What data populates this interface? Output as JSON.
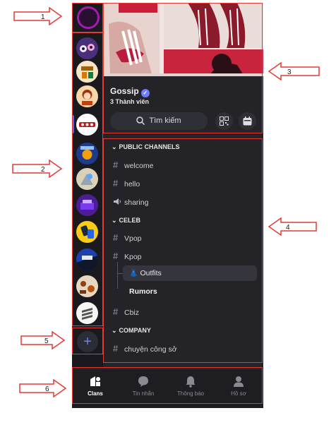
{
  "colors": {
    "accent": "#5865f2",
    "annotation": "#e53935",
    "background": "#232328"
  },
  "server": {
    "name": "Gossip",
    "members": "3 Thành viên"
  },
  "search": {
    "label": "Tìm kiếm"
  },
  "rail": {
    "avatars": [
      "server-1",
      "server-2",
      "server-3",
      "server-4",
      "server-5",
      "server-6",
      "server-7",
      "server-8",
      "server-9",
      "server-10",
      "server-11"
    ]
  },
  "categories": {
    "public": {
      "label": "PUBLIC CHANNELS",
      "channels": [
        "welcome",
        "hello",
        "sharing"
      ]
    },
    "celeb": {
      "label": "CELEB",
      "channels": [
        "Vpop",
        "Kpop"
      ],
      "threads": [
        "Outfits",
        "Rumors"
      ],
      "after": "Cbiz"
    },
    "company": {
      "label": "COMPANY",
      "channels": [
        "chuyện công sở"
      ]
    }
  },
  "tabs": [
    {
      "label": "Clans",
      "icon": "clans-icon"
    },
    {
      "label": "Tin nhắn",
      "icon": "chat-bubble-icon"
    },
    {
      "label": "Thông báo",
      "icon": "bell-icon"
    },
    {
      "label": "Hồ sơ",
      "icon": "profile-icon"
    }
  ],
  "annotations": [
    "1",
    "2",
    "3",
    "4",
    "5",
    "6"
  ]
}
